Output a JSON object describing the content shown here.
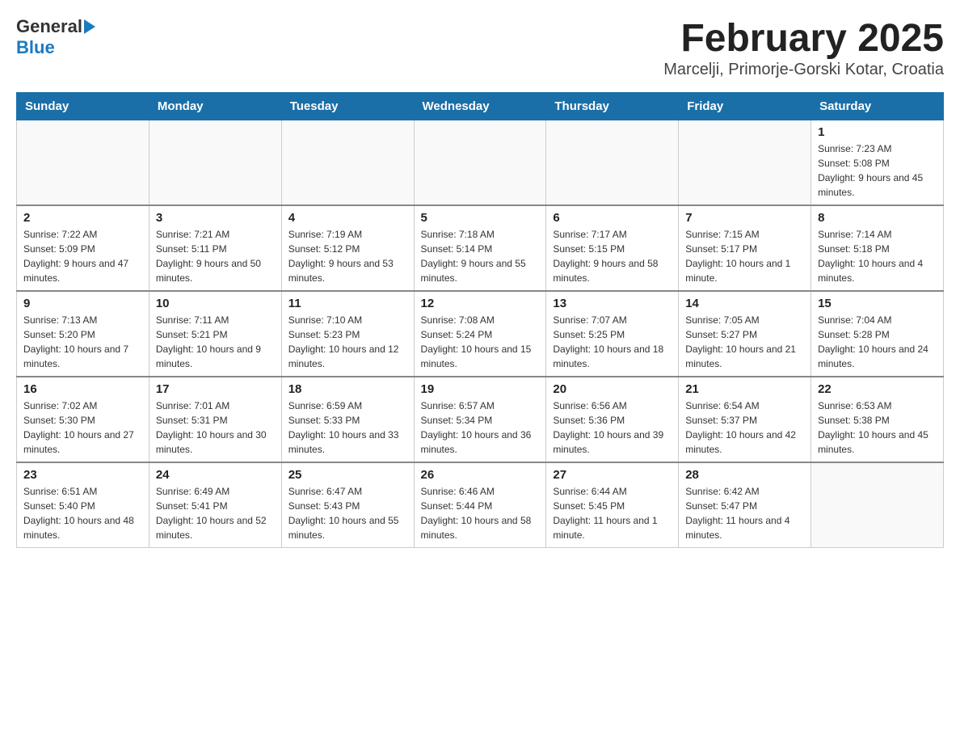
{
  "logo": {
    "text_general": "General",
    "text_blue": "Blue"
  },
  "header": {
    "month_title": "February 2025",
    "location": "Marcelji, Primorje-Gorski Kotar, Croatia"
  },
  "days_of_week": [
    "Sunday",
    "Monday",
    "Tuesday",
    "Wednesday",
    "Thursday",
    "Friday",
    "Saturday"
  ],
  "weeks": [
    {
      "days": [
        {
          "number": "",
          "info": ""
        },
        {
          "number": "",
          "info": ""
        },
        {
          "number": "",
          "info": ""
        },
        {
          "number": "",
          "info": ""
        },
        {
          "number": "",
          "info": ""
        },
        {
          "number": "",
          "info": ""
        },
        {
          "number": "1",
          "info": "Sunrise: 7:23 AM\nSunset: 5:08 PM\nDaylight: 9 hours and 45 minutes."
        }
      ]
    },
    {
      "days": [
        {
          "number": "2",
          "info": "Sunrise: 7:22 AM\nSunset: 5:09 PM\nDaylight: 9 hours and 47 minutes."
        },
        {
          "number": "3",
          "info": "Sunrise: 7:21 AM\nSunset: 5:11 PM\nDaylight: 9 hours and 50 minutes."
        },
        {
          "number": "4",
          "info": "Sunrise: 7:19 AM\nSunset: 5:12 PM\nDaylight: 9 hours and 53 minutes."
        },
        {
          "number": "5",
          "info": "Sunrise: 7:18 AM\nSunset: 5:14 PM\nDaylight: 9 hours and 55 minutes."
        },
        {
          "number": "6",
          "info": "Sunrise: 7:17 AM\nSunset: 5:15 PM\nDaylight: 9 hours and 58 minutes."
        },
        {
          "number": "7",
          "info": "Sunrise: 7:15 AM\nSunset: 5:17 PM\nDaylight: 10 hours and 1 minute."
        },
        {
          "number": "8",
          "info": "Sunrise: 7:14 AM\nSunset: 5:18 PM\nDaylight: 10 hours and 4 minutes."
        }
      ]
    },
    {
      "days": [
        {
          "number": "9",
          "info": "Sunrise: 7:13 AM\nSunset: 5:20 PM\nDaylight: 10 hours and 7 minutes."
        },
        {
          "number": "10",
          "info": "Sunrise: 7:11 AM\nSunset: 5:21 PM\nDaylight: 10 hours and 9 minutes."
        },
        {
          "number": "11",
          "info": "Sunrise: 7:10 AM\nSunset: 5:23 PM\nDaylight: 10 hours and 12 minutes."
        },
        {
          "number": "12",
          "info": "Sunrise: 7:08 AM\nSunset: 5:24 PM\nDaylight: 10 hours and 15 minutes."
        },
        {
          "number": "13",
          "info": "Sunrise: 7:07 AM\nSunset: 5:25 PM\nDaylight: 10 hours and 18 minutes."
        },
        {
          "number": "14",
          "info": "Sunrise: 7:05 AM\nSunset: 5:27 PM\nDaylight: 10 hours and 21 minutes."
        },
        {
          "number": "15",
          "info": "Sunrise: 7:04 AM\nSunset: 5:28 PM\nDaylight: 10 hours and 24 minutes."
        }
      ]
    },
    {
      "days": [
        {
          "number": "16",
          "info": "Sunrise: 7:02 AM\nSunset: 5:30 PM\nDaylight: 10 hours and 27 minutes."
        },
        {
          "number": "17",
          "info": "Sunrise: 7:01 AM\nSunset: 5:31 PM\nDaylight: 10 hours and 30 minutes."
        },
        {
          "number": "18",
          "info": "Sunrise: 6:59 AM\nSunset: 5:33 PM\nDaylight: 10 hours and 33 minutes."
        },
        {
          "number": "19",
          "info": "Sunrise: 6:57 AM\nSunset: 5:34 PM\nDaylight: 10 hours and 36 minutes."
        },
        {
          "number": "20",
          "info": "Sunrise: 6:56 AM\nSunset: 5:36 PM\nDaylight: 10 hours and 39 minutes."
        },
        {
          "number": "21",
          "info": "Sunrise: 6:54 AM\nSunset: 5:37 PM\nDaylight: 10 hours and 42 minutes."
        },
        {
          "number": "22",
          "info": "Sunrise: 6:53 AM\nSunset: 5:38 PM\nDaylight: 10 hours and 45 minutes."
        }
      ]
    },
    {
      "days": [
        {
          "number": "23",
          "info": "Sunrise: 6:51 AM\nSunset: 5:40 PM\nDaylight: 10 hours and 48 minutes."
        },
        {
          "number": "24",
          "info": "Sunrise: 6:49 AM\nSunset: 5:41 PM\nDaylight: 10 hours and 52 minutes."
        },
        {
          "number": "25",
          "info": "Sunrise: 6:47 AM\nSunset: 5:43 PM\nDaylight: 10 hours and 55 minutes."
        },
        {
          "number": "26",
          "info": "Sunrise: 6:46 AM\nSunset: 5:44 PM\nDaylight: 10 hours and 58 minutes."
        },
        {
          "number": "27",
          "info": "Sunrise: 6:44 AM\nSunset: 5:45 PM\nDaylight: 11 hours and 1 minute."
        },
        {
          "number": "28",
          "info": "Sunrise: 6:42 AM\nSunset: 5:47 PM\nDaylight: 11 hours and 4 minutes."
        },
        {
          "number": "",
          "info": ""
        }
      ]
    }
  ]
}
